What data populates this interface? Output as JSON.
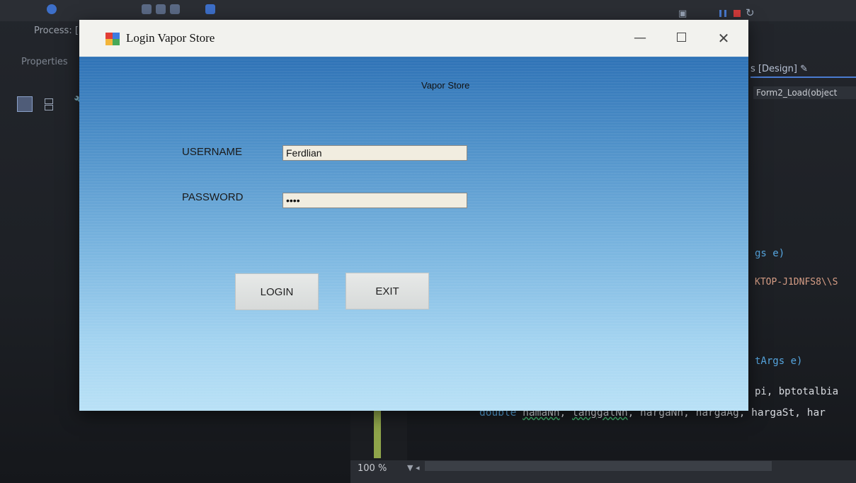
{
  "ide": {
    "process_label": "Process:  [",
    "properties_label": "Properties",
    "design_tab": "s [Design] ✎",
    "method_dropdown": "Form2_Load(object",
    "code": {
      "line1": "gs e)",
      "line2": "KTOP-J1DNFS8\\\\S",
      "line3": "tArgs e)",
      "line4": "pi, bptotalbia",
      "line5_kw": "double",
      "line5_v1": "namaNn",
      "line5_sep1": ", ",
      "line5_v2": "tanggalNn",
      "line5_rest": ", hargaNn, hargaAg, hargaSt, har"
    },
    "zoom": "100 %"
  },
  "window": {
    "title": "Login Vapor Store",
    "min_glyph": "—",
    "close_glyph": "✕"
  },
  "form": {
    "title": "Vapor Store",
    "username_label": "USERNAME",
    "username_value": "Ferdlian",
    "password_label": "PASSWORD",
    "password_value": "••••",
    "login_label": "LOGIN",
    "exit_label": "EXIT"
  }
}
